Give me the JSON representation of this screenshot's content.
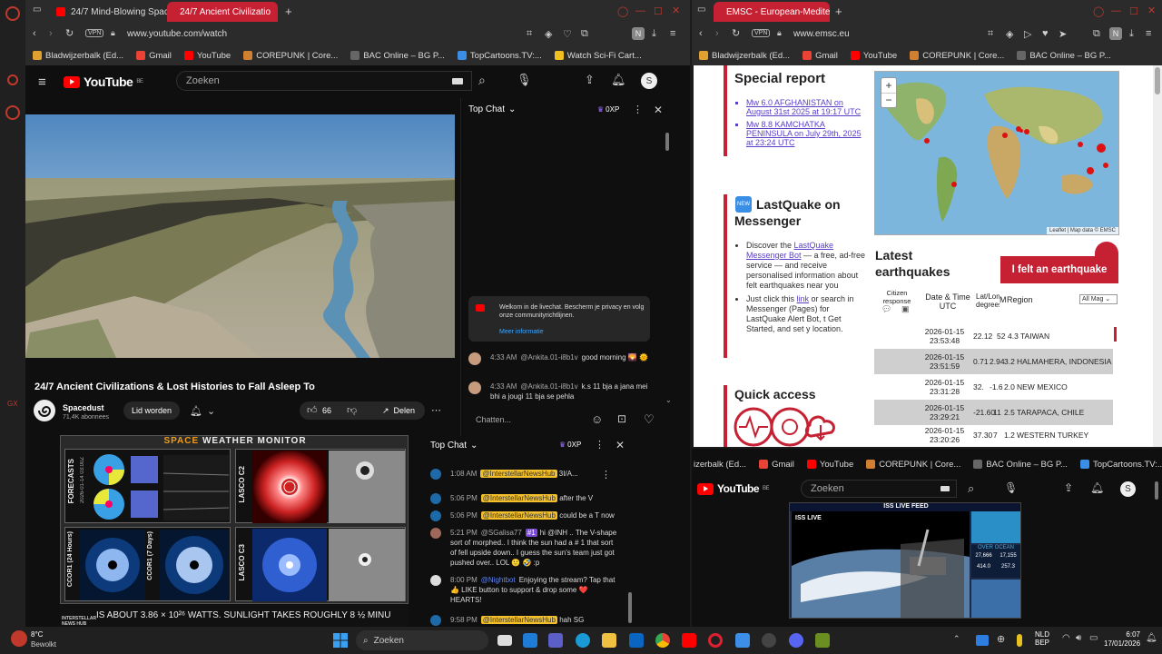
{
  "left_browser": {
    "tabs": [
      {
        "label": "24/7 Mind-Blowing Space"
      },
      {
        "label": "24/7 Ancient Civilizatio",
        "active": true
      }
    ],
    "url": "www.youtube.com/watch",
    "vpn": "VPN",
    "bookmarks": [
      "Bladwijzerbalk (Ed...",
      "Gmail",
      "YouTube",
      "COREPUNK | Core...",
      "BAC Online – BG P...",
      "TopCartoons.TV:...",
      "Watch Sci-Fi Cart..."
    ]
  },
  "right_browser": {
    "tabs": [
      {
        "label": "EMSC - European-Mediter",
        "active": true
      }
    ],
    "url": "www.emsc.eu",
    "vpn": "VPN",
    "bookmarks": [
      "Bladwijzerbalk (Ed...",
      "Gmail",
      "YouTube",
      "COREPUNK | Core...",
      "BAC Online – BG P..."
    ]
  },
  "youtube_main": {
    "logo": "YouTube",
    "logo_region": "BE",
    "search_placeholder": "Zoeken",
    "avatar_letter": "S",
    "video_title": "24/7 Ancient Civilizations & Lost Histories to Fall Asleep To",
    "channel": "Spacedust",
    "subscribers": "71,4K abonnees",
    "join_label": "Lid worden",
    "likes": "66",
    "share_label": "Delen"
  },
  "chat_main": {
    "title": "Top Chat",
    "points": "0XP",
    "welcome": "Welkom in de livechat. Bescherm je privacy en volg onze communityrichtlijnen.",
    "learn_more": "Meer informatie",
    "messages": [
      {
        "time": "4:33 AM",
        "author": "@Ankita.01-i8b1v",
        "text": "good morning 🌄 🌞"
      },
      {
        "time": "4:33 AM",
        "author": "@Ankita.01-i8b1v",
        "text": "k.s 11 bja a jana mei bhi a jougi 11 bja se pehla"
      }
    ],
    "input_placeholder": "Chatten..."
  },
  "space_weather": {
    "title_part1": "SPACE",
    "title_part2": "WEATHER MONITOR",
    "labels": [
      "FORECASTS",
      "LASCO C2",
      "CCOR1 (24 Hours)",
      "CCOR1 (7 Days)",
      "LASCO C3"
    ],
    "forecast_date": "2026-01-14 03:00Z",
    "ticker": "IS ABOUT 3.86 × 10²⁶ WATTS.   SUNLIGHT TAKES ROUGHLY 8 ½ MINU",
    "channel_logo": "INTERSTELLAR NEWS HUB"
  },
  "chat_second": {
    "title": "Top Chat",
    "points": "0XP",
    "messages": [
      {
        "time": "1:08 AM",
        "author": "@InterstellarNewsHub",
        "text": "3I/A..."
      },
      {
        "time": "5:06 PM",
        "author": "@InterstellarNewsHub",
        "text": "after the V"
      },
      {
        "time": "5:06 PM",
        "author": "@InterstellarNewsHub",
        "text": "could be a T now"
      },
      {
        "time": "5:21 PM",
        "author": "@SGalisa77",
        "badge": "#1",
        "text": "hi @INH .. The V-shape sort of morphed.. I think the sun had a # 1 that sort of fell upside down.. I guess the sun's team just got pushed over.. LOL 🙂 🤣 :p"
      },
      {
        "time": "8:00 PM",
        "author": "@Nightbot",
        "text": "Enjoying the stream? Tap that 👍 LIKE button to support & drop some ❤️ HEARTS!"
      },
      {
        "time": "9:58 PM",
        "author": "@InterstellarNewsHub",
        "text": "hah SG"
      }
    ]
  },
  "emsc": {
    "special_report_title": "Special report",
    "reports": [
      "Mw 6.0 AFGHANISTAN on August 31st 2025 at 19:17 UTC",
      "Mw 8.8 KAMCHATKA PENINSULA on July 29th, 2025 at 23:24 UTC"
    ],
    "lastquake_title": "LastQuake on Messenger",
    "lastquake_badge": "NEW",
    "bullet1_a": "Discover the ",
    "bullet1_link": "LastQuake Messenger Bot",
    "bullet1_b": " — a free, ad-free service — and receive personalised information about felt earthquakes near you",
    "bullet2_a": "Just click this ",
    "bullet2_link": "link",
    "bullet2_b": " or search in Messenger (Pages) for LastQuake Alert Bot, t Get Started, and set y location.",
    "quick_access": "Quick access",
    "map_attribution": "Leaflet | Map data © EMSC",
    "map_zoom_in": "+",
    "map_zoom_out": "−",
    "latest_title": "Latest earthquakes",
    "felt_button": "I felt an earthquake",
    "col_citizen": "Citizen response",
    "col_datetime": "Date & Time UTC",
    "col_latlon": "Lat/Lon degrees",
    "col_mag": "M",
    "col_region": "Region",
    "filter": "All Mag",
    "rows": [
      {
        "date": "2026-01-15",
        "time": "23:53:48",
        "lat": "22.12",
        "lon": "52",
        "mag": "4.3",
        "region": "TAIWAN"
      },
      {
        "date": "2026-01-15",
        "time": "23:51:59",
        "lat": "0.71",
        "lon": "2.94",
        "mag": "3.2",
        "region": "HALMAHERA, INDONESIA"
      },
      {
        "date": "2026-01-15",
        "time": "23:31:28",
        "lat": "32.",
        "lon": "-1.6",
        "mag": "2.0",
        "region": "NEW MEXICO"
      },
      {
        "date": "2026-01-15",
        "time": "23:29:21",
        "lat": "-21.60",
        "lon": "11",
        "mag": "2.5",
        "region": "TARAPACA, CHILE"
      },
      {
        "date": "2026-01-15",
        "time": "23:20:26",
        "lat": "37.30",
        "lon": "7",
        "mag": "1.2",
        "region": "WESTERN TURKEY"
      }
    ]
  },
  "youtube_small": {
    "bookmarks": [
      "izerbalk (Ed...",
      "Gmail",
      "YouTube",
      "COREPUNK | Core...",
      "BAC Online – BG P...",
      "TopCartoons.TV:..."
    ],
    "logo": "YouTube",
    "logo_region": "BE",
    "search_placeholder": "Zoeken",
    "avatar_letter": "S",
    "iss_banner": "ISS LIVE FEED",
    "iss_live": "ISS LIVE",
    "over_ocean": "OVER OCEAN",
    "stat1": "27,666",
    "stat2": "17,155",
    "stat3": "414.0",
    "stat4": "257.3"
  },
  "taskbar": {
    "weather_temp": "8°C",
    "weather_desc": "Bewolkt",
    "search_placeholder": "Zoeken",
    "lang1": "NLD",
    "lang2": "BEP",
    "time": "6:07",
    "date": "17/01/2026"
  }
}
